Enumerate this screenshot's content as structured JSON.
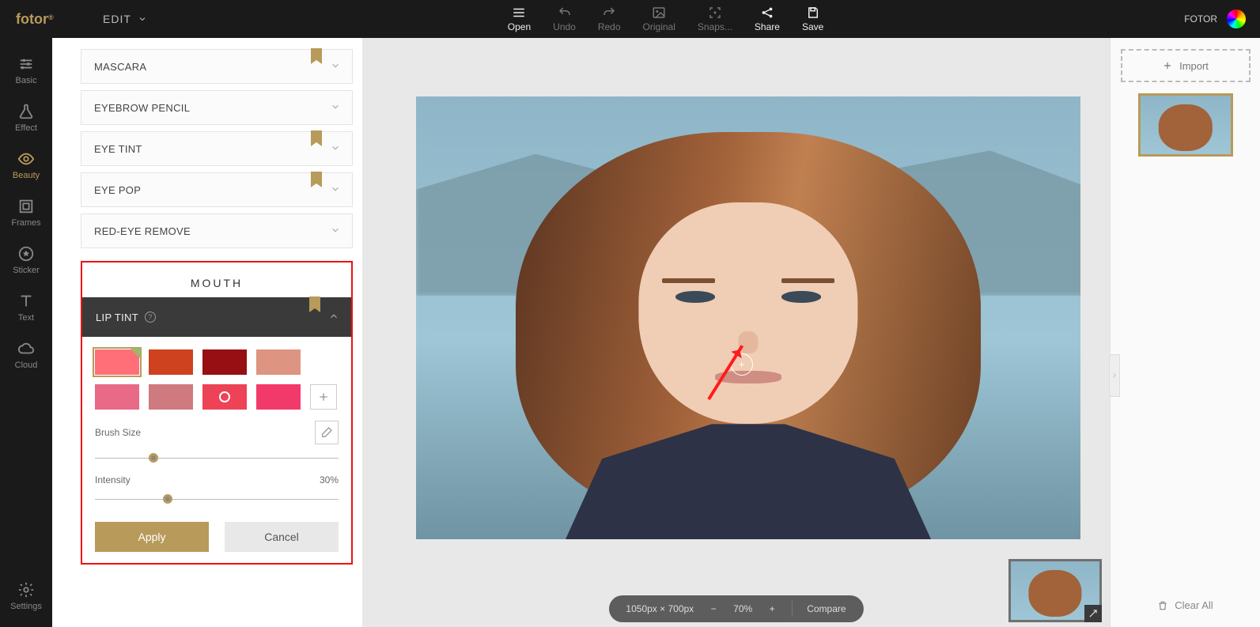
{
  "brand_name": "fotor",
  "edit_label": "EDIT",
  "top_icons": [
    {
      "name": "open",
      "label": "Open",
      "glyph": "menu",
      "on": true
    },
    {
      "name": "undo",
      "label": "Undo",
      "glyph": "undo",
      "on": false
    },
    {
      "name": "redo",
      "label": "Redo",
      "glyph": "redo",
      "on": false
    },
    {
      "name": "original",
      "label": "Original",
      "glyph": "image",
      "on": false
    },
    {
      "name": "snaps",
      "label": "Snaps...",
      "glyph": "focus",
      "on": false
    },
    {
      "name": "share",
      "label": "Share",
      "glyph": "share",
      "on": true
    },
    {
      "name": "save",
      "label": "Save",
      "glyph": "save",
      "on": true
    }
  ],
  "user_label": "FOTOR",
  "rail": [
    {
      "name": "basic",
      "label": "Basic",
      "glyph": "sliders"
    },
    {
      "name": "effect",
      "label": "Effect",
      "glyph": "flask"
    },
    {
      "name": "beauty",
      "label": "Beauty",
      "glyph": "eye",
      "active": true
    },
    {
      "name": "frames",
      "label": "Frames",
      "glyph": "frame"
    },
    {
      "name": "sticker",
      "label": "Sticker",
      "glyph": "star"
    },
    {
      "name": "text",
      "label": "Text",
      "glyph": "text"
    },
    {
      "name": "cloud",
      "label": "Cloud",
      "glyph": "cloud"
    }
  ],
  "rail_bottom": {
    "name": "settings",
    "label": "Settings",
    "glyph": "gear"
  },
  "accordions": [
    {
      "name": "mascara",
      "label": "MASCARA",
      "bookmark": true
    },
    {
      "name": "eyebrow-pencil",
      "label": "EYEBROW PENCIL",
      "bookmark": false
    },
    {
      "name": "eye-tint",
      "label": "EYE TINT",
      "bookmark": true
    },
    {
      "name": "eye-pop",
      "label": "EYE POP",
      "bookmark": true
    },
    {
      "name": "red-eye-remove",
      "label": "RED-EYE REMOVE",
      "bookmark": false
    }
  ],
  "mouth_section_title": "MOUTH",
  "lip_tint": {
    "label": "LIP TINT",
    "swatches_row1": [
      {
        "color": "#ff6f78",
        "selected": true
      },
      {
        "color": "#cf421f"
      },
      {
        "color": "#970f13"
      },
      {
        "color": "#dd9480"
      }
    ],
    "swatches_row2": [
      {
        "color": "#e86a86"
      },
      {
        "color": "#cf7a7e"
      },
      {
        "color": "#ee4256",
        "ring": true
      },
      {
        "color": "#f23a6a"
      }
    ],
    "brush_label": "Brush Size",
    "brush_pos_pct": 24,
    "intensity_label": "Intensity",
    "intensity_value": "30%",
    "intensity_pos_pct": 30,
    "apply_label": "Apply",
    "cancel_label": "Cancel"
  },
  "zoom": {
    "dims": "1050px × 700px",
    "value": "70%",
    "compare_label": "Compare"
  },
  "rside": {
    "import_label": "Import",
    "clear_label": "Clear All"
  }
}
